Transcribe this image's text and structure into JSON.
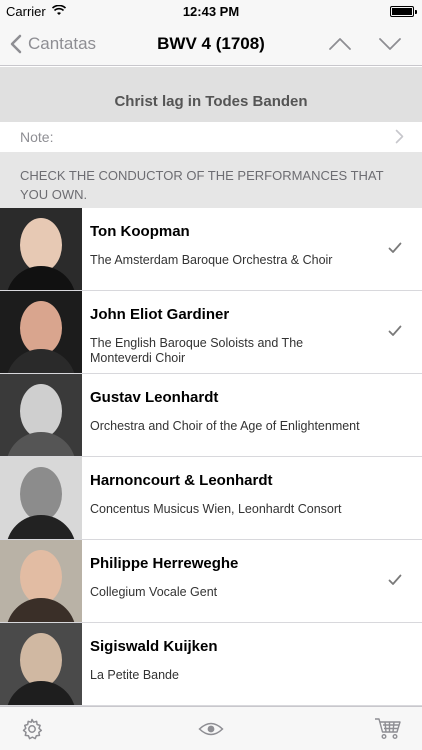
{
  "status_bar": {
    "carrier": "Carrier",
    "time": "12:43 PM"
  },
  "nav": {
    "back_label": "Cantatas",
    "title": "BWV 4 (1708)"
  },
  "cantata": {
    "title": "Christ lag in Todes Banden"
  },
  "note": {
    "label": "Note:"
  },
  "section": {
    "header": "CHECK THE CONDUCTOR OF THE PERFORMANCES THAT YOU OWN."
  },
  "performances": [
    {
      "conductor": "Ton Koopman",
      "ensemble": "The Amsterdam Baroque Orchestra & Choir",
      "owned": true,
      "photo": {
        "bg": "#2b2b2b",
        "face": "#e7c9b4",
        "clothes": "#111111"
      }
    },
    {
      "conductor": "John Eliot Gardiner",
      "ensemble": "The English Baroque Soloists and The Monteverdi Choir",
      "owned": true,
      "photo": {
        "bg": "#1c1c1c",
        "face": "#d9a58e",
        "clothes": "#2a2a2a"
      }
    },
    {
      "conductor": "Gustav Leonhardt",
      "ensemble": "Orchestra and Choir of the Age of Enlightenment",
      "owned": false,
      "photo": {
        "bg": "#3a3a3a",
        "face": "#cfcfcf",
        "clothes": "#555555"
      }
    },
    {
      "conductor": "Harnoncourt & Leonhardt",
      "ensemble": "Concentus Musicus Wien, Leonhardt Consort",
      "owned": false,
      "photo": {
        "bg": "#d8d8d8",
        "face": "#8c8c8c",
        "clothes": "#222222"
      }
    },
    {
      "conductor": "Philippe Herreweghe",
      "ensemble": "Collegium Vocale Gent",
      "owned": true,
      "photo": {
        "bg": "#b9b2a6",
        "face": "#e2bca3",
        "clothes": "#3a2f28"
      }
    },
    {
      "conductor": "Sigiswald Kuijken",
      "ensemble": "La Petite Bande",
      "owned": false,
      "photo": {
        "bg": "#4a4a4a",
        "face": "#d0b8a2",
        "clothes": "#1e1e1e"
      }
    }
  ],
  "tab_bar": {
    "icons": [
      "gear-icon",
      "eye-icon",
      "cart-icon"
    ]
  },
  "colors": {
    "nav_bg": "#f7f7f7",
    "section_bg": "#e6e6e6",
    "accent_gray": "#8e8e93",
    "check": "#7a7a7a"
  }
}
